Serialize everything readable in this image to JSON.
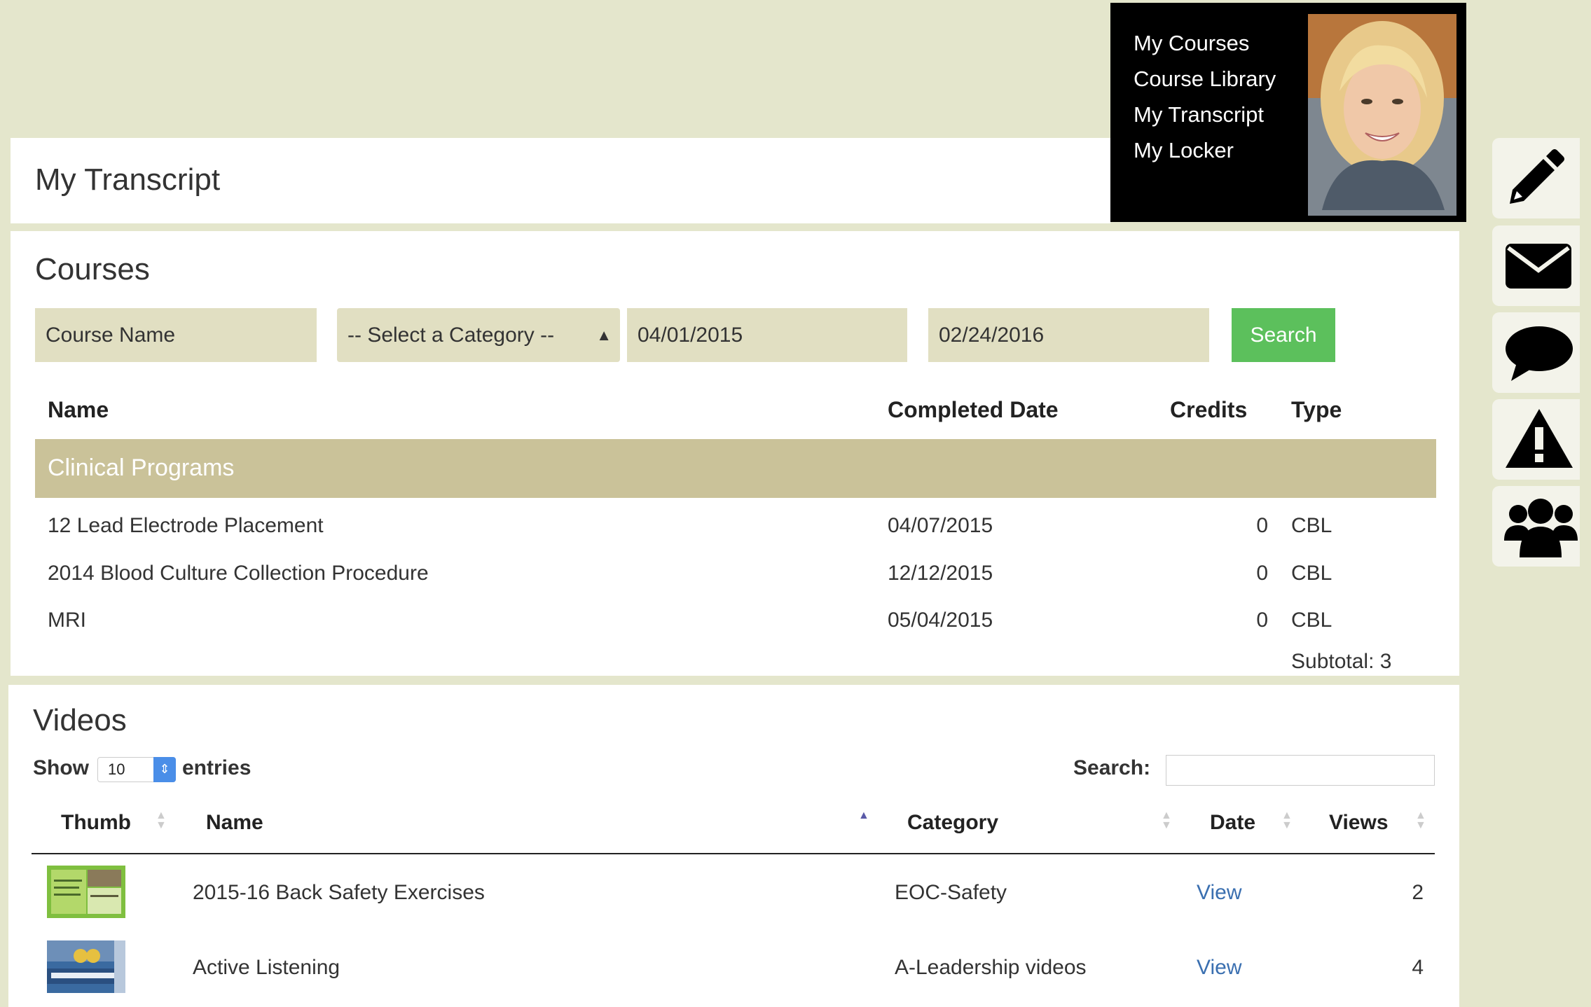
{
  "nav": {
    "items": [
      "My Courses",
      "Course Library",
      "My Transcript",
      "My Locker"
    ]
  },
  "page_title": "My Transcript",
  "courses": {
    "title": "Courses",
    "filters": {
      "course_name": "Course Name",
      "category": "-- Select a Category --",
      "date_from": "04/01/2015",
      "date_to": "02/24/2016",
      "search_label": "Search"
    },
    "columns": [
      "Name",
      "Completed Date",
      "Credits",
      "Type"
    ],
    "group": "Clinical Programs",
    "rows": [
      {
        "name": "12 Lead Electrode Placement",
        "date": "04/07/2015",
        "credits": "0",
        "type": "CBL"
      },
      {
        "name": "2014 Blood Culture Collection Procedure",
        "date": "12/12/2015",
        "credits": "0",
        "type": "CBL"
      },
      {
        "name": "MRI",
        "date": "05/04/2015",
        "credits": "0",
        "type": "CBL"
      }
    ],
    "subtotal": "Subtotal: 3"
  },
  "videos": {
    "title": "Videos",
    "show_label": "Show",
    "show_value": "10",
    "entries_label": "entries",
    "search_label": "Search:",
    "columns": [
      "Thumb",
      "Name",
      "Category",
      "Date",
      "Views"
    ],
    "rows": [
      {
        "name": "2015-16 Back Safety Exercises",
        "category": "EOC-Safety",
        "date": "View",
        "views": "2"
      },
      {
        "name": "Active Listening",
        "category": "A-Leadership videos",
        "date": "View",
        "views": "4"
      }
    ]
  },
  "toolbar": {
    "icons": [
      "pencil-icon",
      "envelope-icon",
      "chat-bubble-icon",
      "warning-icon",
      "users-icon"
    ]
  },
  "colors": {
    "background": "#e4e6cc",
    "field": "#e1dfc2",
    "group_row": "#cac299",
    "search_button": "#5cc05c",
    "link": "#3a6fb0"
  }
}
